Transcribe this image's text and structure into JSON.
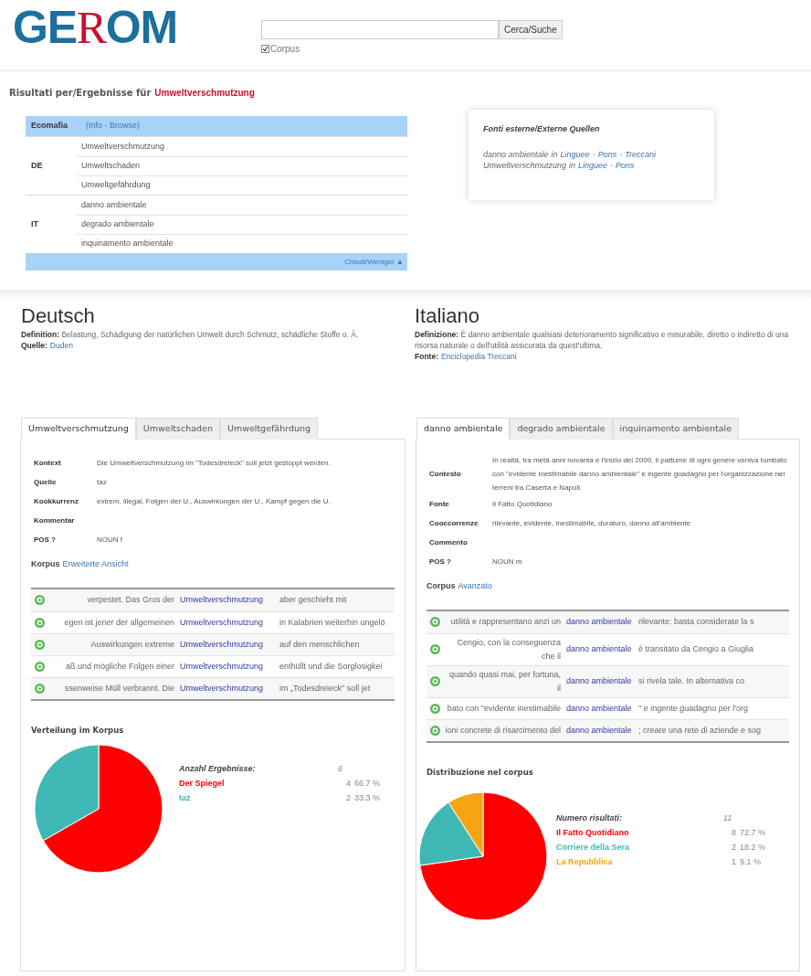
{
  "logo": [
    {
      "text": "GE",
      "kind": "sans"
    },
    {
      "text": "R",
      "kind": "serif"
    },
    {
      "text": "OM",
      "kind": "sans"
    }
  ],
  "search": {
    "button": "Cerca/Suche",
    "corpus_label": "Corpus",
    "corpus_checked": true
  },
  "results_title": {
    "prefix": "Risultati per/Ergebnisse für",
    "term": "Umweltverschmutzung"
  },
  "terms_table": {
    "header": {
      "label": "Ecomafia",
      "links": "(Info - Browse)"
    },
    "groups": [
      {
        "lang": "DE",
        "terms": [
          "Umweltverschmutzung",
          "Umweltschaden",
          "Umweltgefährdung"
        ]
      },
      {
        "lang": "IT",
        "terms": [
          "danno ambientale",
          "degrado ambientale",
          "inquinamento ambientale"
        ]
      }
    ],
    "footer": "Chiudi/Weniger ▲"
  },
  "external_sources": {
    "title": "Fonti esterne/Externe Quellen",
    "separator": "-",
    "lines": [
      {
        "term": "danno ambientale",
        "in": "in",
        "links": [
          "Linguee",
          "Pons",
          "Treccani"
        ]
      },
      {
        "term": "Umweltverschmutzung",
        "in": "in",
        "links": [
          "Linguee",
          "Pons"
        ]
      }
    ]
  },
  "languages": [
    {
      "name": "Deutsch",
      "definition": "**Definition:** Belastung, Schädigung der natürlichen Umwelt durch Schmutz, schädliche Stoffe o. Ä.",
      "source_label": "Quelle:",
      "source": "Duden"
    },
    {
      "name": "Italiano",
      "definition": "**Definizione:** È danno ambientale qualsiasi deterioramento significativo e misurabile, diretto o indiretto di una risorsa naturale o dell'utilità assicurata da quest'ultima.",
      "source_label": "Fonte:",
      "source": "Enciclopedia Treccani"
    }
  ],
  "panels": [
    {
      "tabs": [
        {
          "label": "Umweltverschmutzung",
          "selected": true
        },
        {
          "label": "Umweltschaden",
          "selected": false
        },
        {
          "label": "Umweltgefährdung",
          "selected": false
        }
      ],
      "info": [
        {
          "label": "Kontext",
          "value": "Die Umweltverschmutzung im \"Todesdreieck\" soll jetzt gestoppt werden."
        },
        {
          "label": "Quelle",
          "value": "taz"
        },
        {
          "label": "Kookkurrenz",
          "value": "extrem, illegal, Folgen der U., Auswirkungen der U., Kampf gegen die U."
        },
        {
          "label": "Kommentar"
        },
        {
          "label": "POS ?",
          "value": "NOUN f"
        }
      ],
      "corpus": {
        "label": "Korpus",
        "link": "Erweiterte Ansicht"
      },
      "concordance": [
        {
          "left": "verpestet. Das Gros der",
          "key": "Umweltverschmutzung",
          "right": "aber geschieht mit"
        },
        {
          "left": "egen ist jener der allgemeinen",
          "key": "Umweltverschmutzung",
          "right": "in Kalabrien weiterhin ungelö"
        },
        {
          "left": "Auswirkungen extreme",
          "key": "Umweltverschmutzung",
          "right": "auf den menschlichen"
        },
        {
          "left": "aß und mögliche Folgen einer",
          "key": "Umweltverschmutzung",
          "right": "enthüllt und die Sorglosigkei"
        },
        {
          "left": "ssenweise Müll verbrannt. Die",
          "key": "Umweltverschmutzung",
          "right": "im „Todesdreieck\" soll jet"
        }
      ],
      "distribution": {
        "title": "Verteilung im Korpus",
        "chart_data": {
          "type": "pie",
          "categories": [
            "Der Spiegel",
            "taz"
          ],
          "values": [
            66.7,
            33.3
          ]
        },
        "legend": {
          "title": "Anzahl Ergebnisse:",
          "total": "6",
          "items": [
            {
              "count": "4",
              "percent": "66.7 %",
              "color": "#ff0000"
            },
            {
              "count": "2",
              "percent": "33.3 %",
              "color": "#3fb8b5"
            }
          ]
        }
      }
    },
    {
      "tabs": [
        {
          "label": "danno ambientale",
          "selected": true
        },
        {
          "label": "degrado ambientale",
          "selected": false
        },
        {
          "label": "inquinamento ambientale",
          "selected": false
        }
      ],
      "info": [
        {
          "label": "Contesto",
          "value": "In realtà, tra metà anni novanta e l'inizio del 2000, il pattume di ogni genere veniva tombato con \"evidente inestimabile danno ambientale\" e ingente guadagno per l'organizzazione nei terreni tra Caserta e Napoli."
        },
        {
          "label": "Fonte",
          "value": "Il Fatto Quotidiano"
        },
        {
          "label": "Cooccorrenze",
          "value": "rilevante, evidente, inestimabile, duraturo, danno all'ambiente"
        },
        {
          "label": "Commento"
        },
        {
          "label": "POS ?",
          "value": "NOUN m"
        }
      ],
      "corpus": {
        "label": "Corpus",
        "link": "Avanzato"
      },
      "concordance": [
        {
          "left": "utilità e rappresentano anzi un",
          "key": "danno ambientale",
          "right": "rilevante: basta considerate la s"
        },
        {
          "left": "Cengio, con la conseguenza che il",
          "key": "danno ambientale",
          "right": "è transitato da Cengio a Giuglia"
        },
        {
          "left": "quando quasi mai, per fortuna, il",
          "key": "danno ambientale",
          "right": "si rivela tale. In alternativa co"
        },
        {
          "left": "bato con \"evidente inestimabile",
          "key": "danno ambientale",
          "right": "\" e ingente guadagno per l'org"
        },
        {
          "left": "ioni concrete di risarcimento del",
          "key": "danno ambientale",
          "right": "; creare una rete di aziende e sog"
        }
      ],
      "distribution": {
        "title": "Distribuzione nel corpus",
        "chart_data": {
          "type": "pie",
          "categories": [
            "Il Fatto Quotidiano",
            "Corriere della Sera",
            "La Repubblica"
          ],
          "values": [
            72.7,
            18.2,
            9.1
          ]
        },
        "legend": {
          "title": "Numero risultati:",
          "total": "11",
          "items": [
            {
              "count": "8",
              "percent": "72.7 %",
              "color": "#ff0000"
            },
            {
              "count": "2",
              "percent": "18.2 %",
              "color": "#3fb8b5"
            },
            {
              "count": "1",
              "percent": "9.1 %",
              "color": "#f5a511"
            }
          ]
        }
      }
    }
  ]
}
